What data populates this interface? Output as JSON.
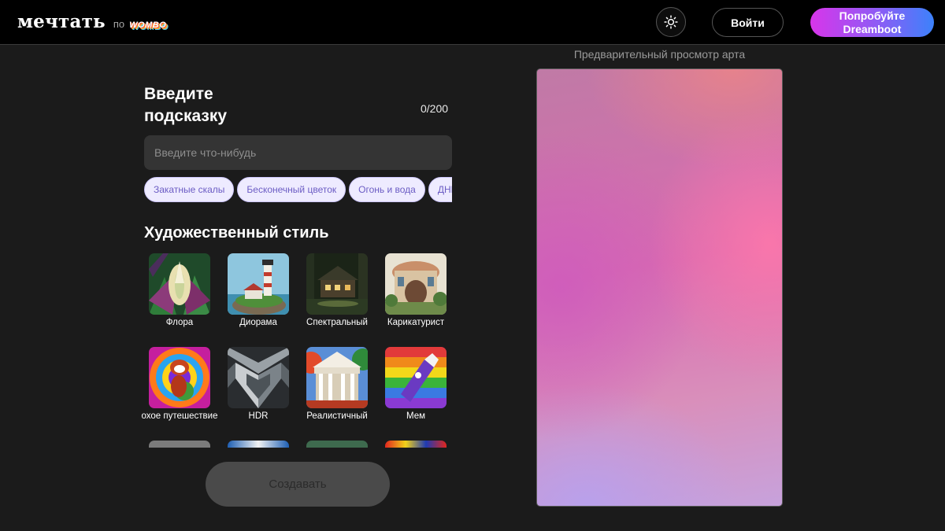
{
  "header": {
    "logo_text": "мечтать",
    "logo_by": "по",
    "logo_brand": "WOMBO",
    "theme_icon": "sun-icon",
    "login_label": "Войти",
    "try_line1": "Попробуйте",
    "try_line2": "Dreamboot"
  },
  "prompt": {
    "title": "Введите подсказку",
    "char_count": "0/200",
    "placeholder": "Введите что-нибудь",
    "value": "",
    "suggestions": [
      "Закатные скалы",
      "Бесконечный цветок",
      "Огонь и вода",
      "ДНК торговые"
    ]
  },
  "styles": {
    "title": "Художественный стиль",
    "items": [
      {
        "label": "Флора"
      },
      {
        "label": "Диорама"
      },
      {
        "label": "Спектральный"
      },
      {
        "label": "Карикатурист"
      },
      {
        "label": "охое путешествие"
      },
      {
        "label": "HDR"
      },
      {
        "label": "Реалистичный"
      },
      {
        "label": "Мем"
      }
    ]
  },
  "create_label": "Создавать",
  "preview": {
    "label": "Предварительный просмотр арта"
  }
}
